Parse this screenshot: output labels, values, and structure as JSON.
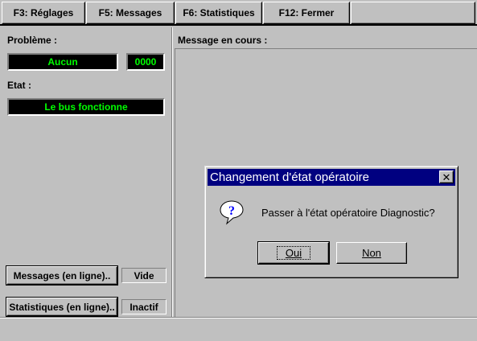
{
  "tabs": [
    {
      "label": "F3: Réglages"
    },
    {
      "label": "F5: Messages"
    },
    {
      "label": "F6: Statistiques"
    },
    {
      "label": "F12: Fermer"
    }
  ],
  "left": {
    "probleme_label": "Problème :",
    "probleme_value": "Aucun",
    "probleme_code": "0000",
    "etat_label": "Etat :",
    "etat_value": "Le bus fonctionne",
    "messages_button": "Messages (en ligne)..",
    "messages_status": "Vide",
    "stats_button": "Statistiques (en ligne)..",
    "stats_status": "Inactif"
  },
  "main": {
    "message_label": "Message en cours :"
  },
  "dialog": {
    "title": "Changement d'état opératoire",
    "close": "✕",
    "icon": "question-icon",
    "message": "Passer à l'état opératoire Diagnostic?",
    "yes": "Oui",
    "no": "Non"
  },
  "colors": {
    "lcd_text": "#00ff00",
    "titlebar": "#000080"
  }
}
